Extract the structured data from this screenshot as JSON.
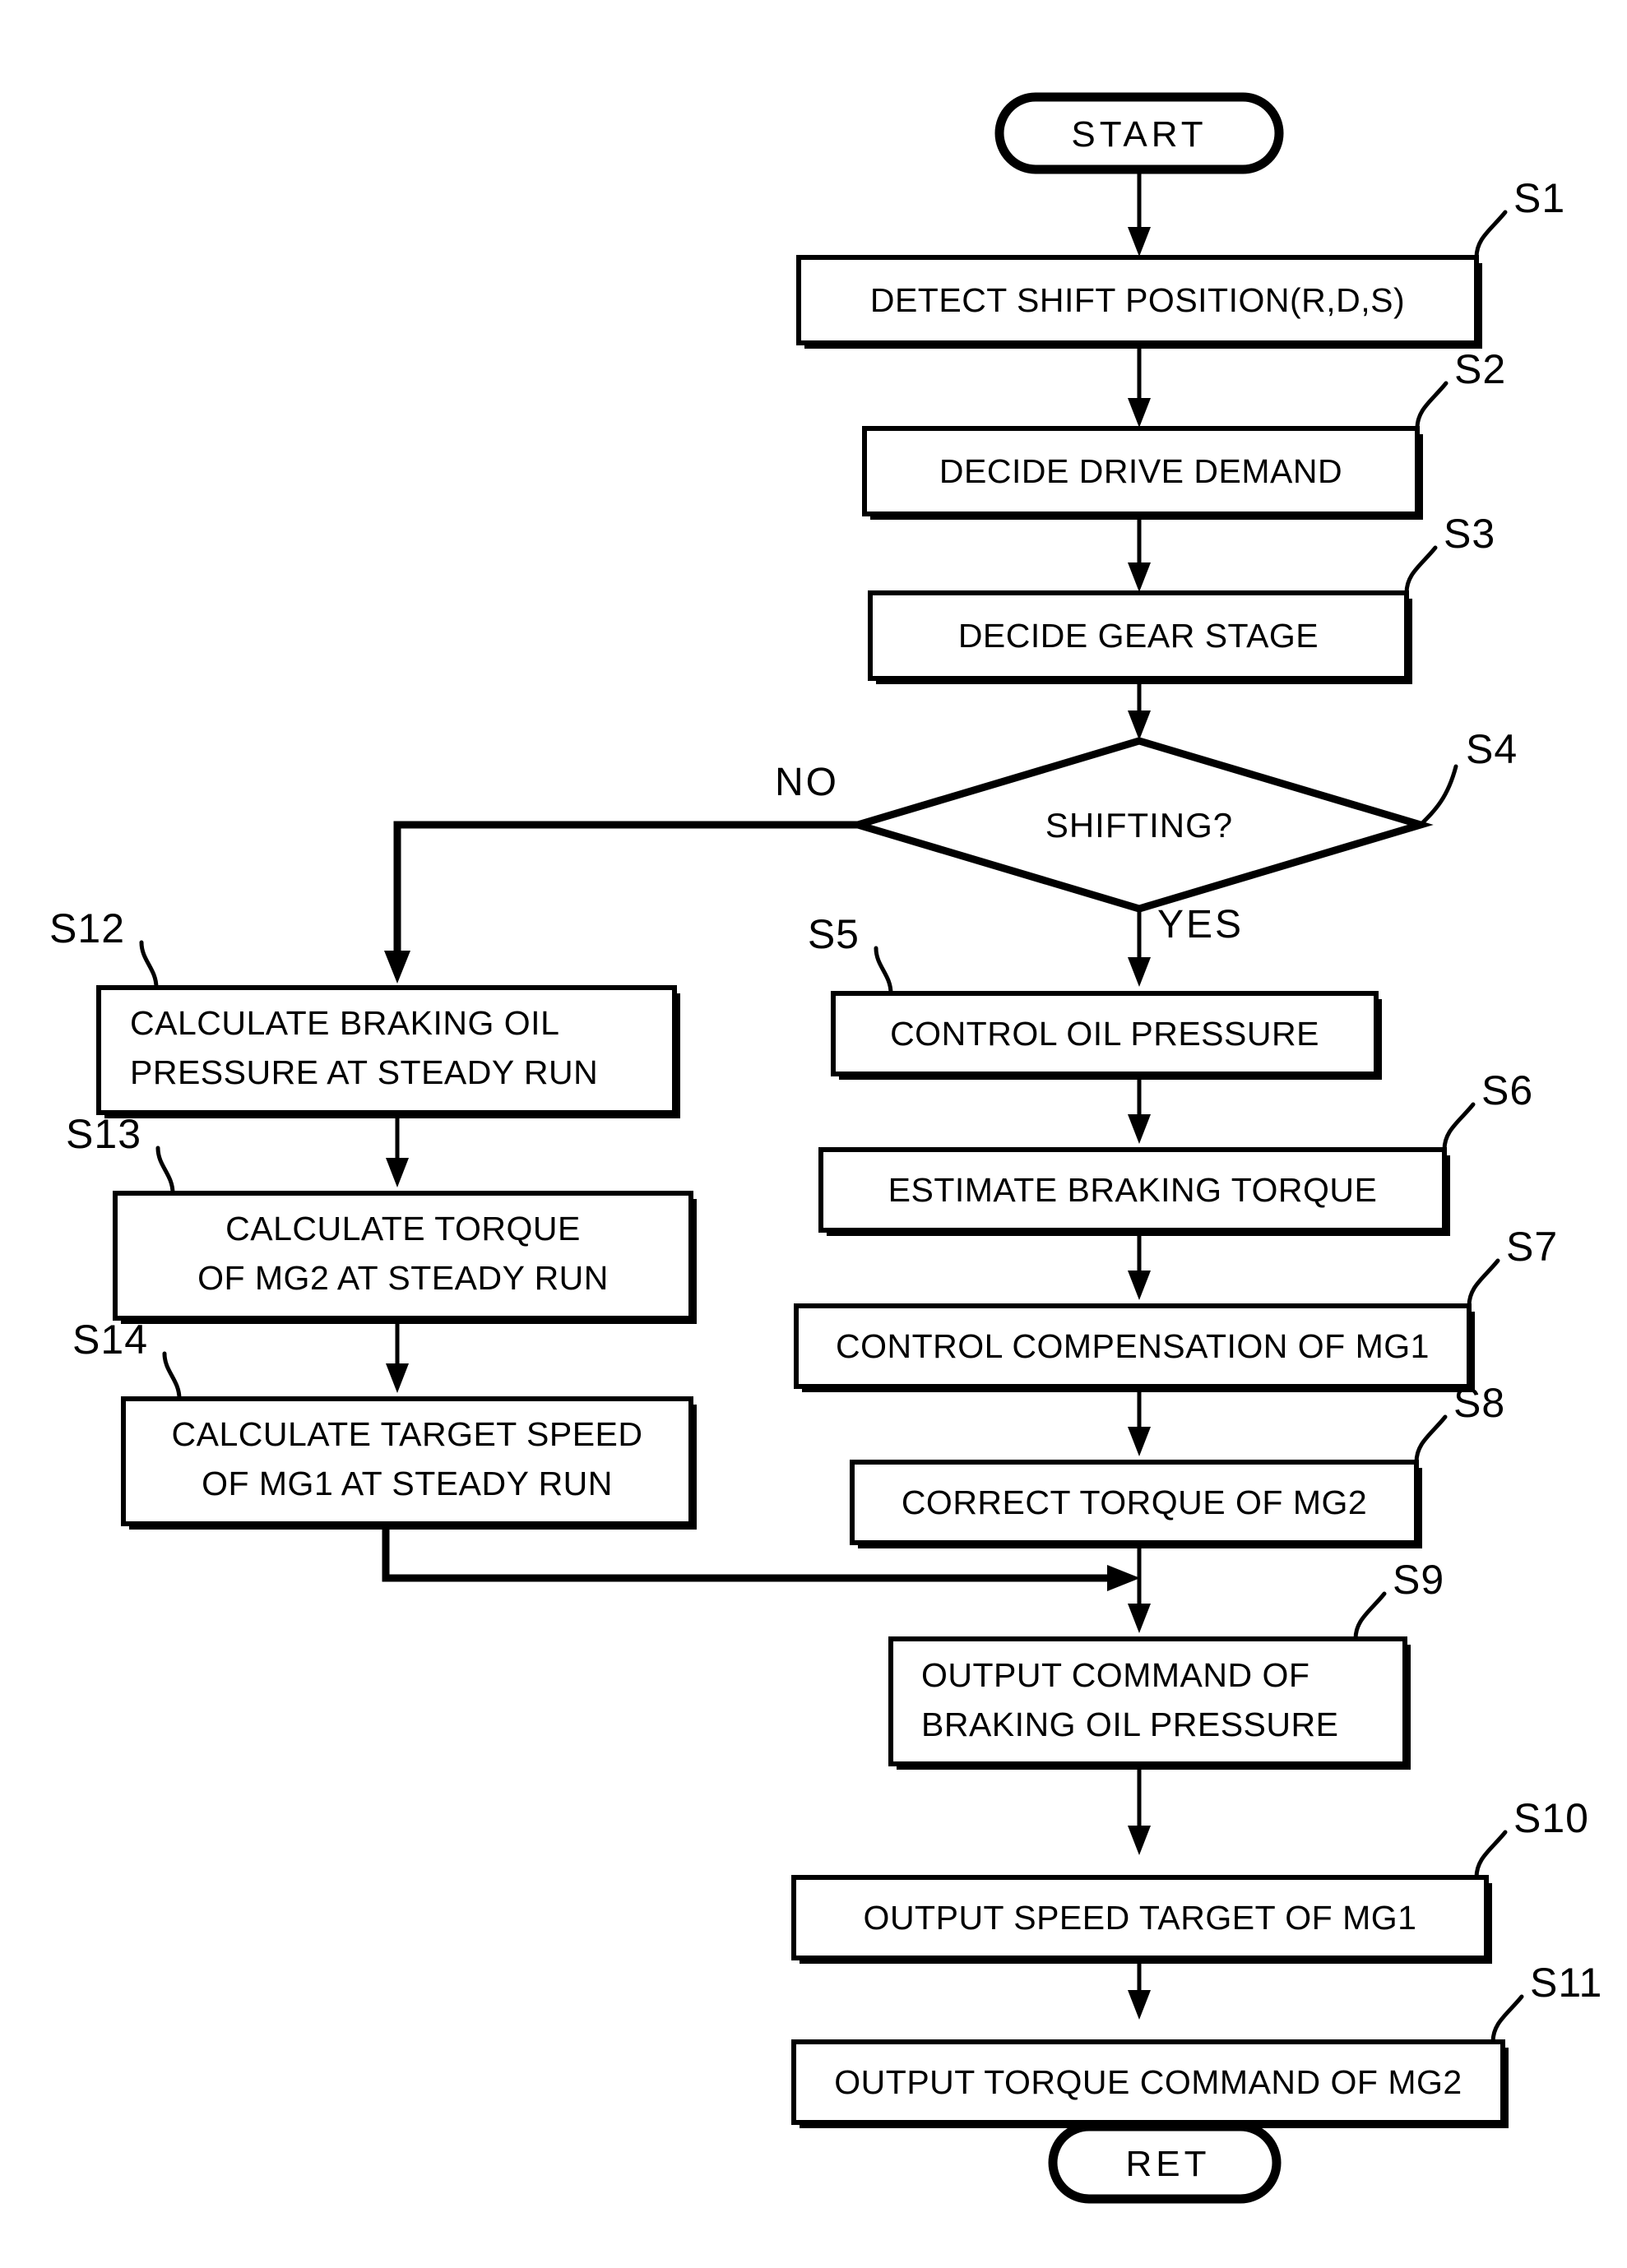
{
  "diagram": {
    "type": "flowchart",
    "title": "",
    "orientation": "top-to-bottom",
    "terminals": {
      "start": "START",
      "end": "RET"
    },
    "decision": {
      "id": "S4",
      "text": "SHIFTING?",
      "yes_label": "YES",
      "no_label": "NO"
    },
    "steps": [
      {
        "id": "S1",
        "lines": [
          "DETECT SHIFT POSITION(R,D,S)"
        ]
      },
      {
        "id": "S2",
        "lines": [
          "DECIDE DRIVE DEMAND"
        ]
      },
      {
        "id": "S3",
        "lines": [
          "DECIDE GEAR STAGE"
        ]
      },
      {
        "id": "S5",
        "lines": [
          "CONTROL OIL PRESSURE"
        ]
      },
      {
        "id": "S6",
        "lines": [
          "ESTIMATE BRAKING TORQUE"
        ]
      },
      {
        "id": "S7",
        "lines": [
          "CONTROL COMPENSATION OF MG1"
        ]
      },
      {
        "id": "S8",
        "lines": [
          "CORRECT TORQUE OF MG2"
        ]
      },
      {
        "id": "S9",
        "lines": [
          "OUTPUT COMMAND OF",
          "BRAKING OIL PRESSURE"
        ]
      },
      {
        "id": "S10",
        "lines": [
          "OUTPUT SPEED TARGET OF MG1"
        ]
      },
      {
        "id": "S11",
        "lines": [
          "OUTPUT TORQUE COMMAND OF MG2"
        ]
      },
      {
        "id": "S12",
        "lines": [
          "CALCULATE BRAKING OIL",
          "PRESSURE AT STEADY RUN"
        ]
      },
      {
        "id": "S13",
        "lines": [
          "CALCULATE TORQUE",
          "OF MG2 AT STEADY RUN"
        ]
      },
      {
        "id": "S14",
        "lines": [
          "CALCULATE TARGET SPEED",
          "OF MG1 AT STEADY RUN"
        ]
      }
    ],
    "labels": {
      "s1": "S1",
      "s2": "S2",
      "s3": "S3",
      "s4": "S4",
      "s5": "S5",
      "s6": "S6",
      "s7": "S7",
      "s8": "S8",
      "s9": "S9",
      "s10": "S10",
      "s11": "S11",
      "s12": "S12",
      "s13": "S13",
      "s14": "S14"
    },
    "box_text": {
      "s1_l1": "DETECT SHIFT POSITION(R,D,S)",
      "s2_l1": "DECIDE DRIVE DEMAND",
      "s3_l1": "DECIDE GEAR STAGE",
      "s4_l1": "SHIFTING?",
      "s5_l1": "CONTROL OIL PRESSURE",
      "s6_l1": "ESTIMATE BRAKING TORQUE",
      "s7_l1": "CONTROL COMPENSATION OF MG1",
      "s8_l1": "CORRECT TORQUE OF MG2",
      "s9_l1": "OUTPUT COMMAND OF",
      "s9_l2": "BRAKING OIL PRESSURE",
      "s10_l1": "OUTPUT SPEED TARGET OF MG1",
      "s11_l1": "OUTPUT TORQUE COMMAND OF MG2",
      "s12_l1": "CALCULATE BRAKING OIL",
      "s12_l2": "PRESSURE AT STEADY RUN",
      "s13_l1": "CALCULATE TORQUE",
      "s13_l2": "OF MG2 AT STEADY RUN",
      "s14_l1": "CALCULATE TARGET SPEED",
      "s14_l2": "OF MG1 AT STEADY RUN",
      "start": "START",
      "ret": "RET",
      "yes": "YES",
      "no": "NO"
    },
    "colors": {
      "ink": "#000000",
      "paper": "#ffffff"
    }
  }
}
